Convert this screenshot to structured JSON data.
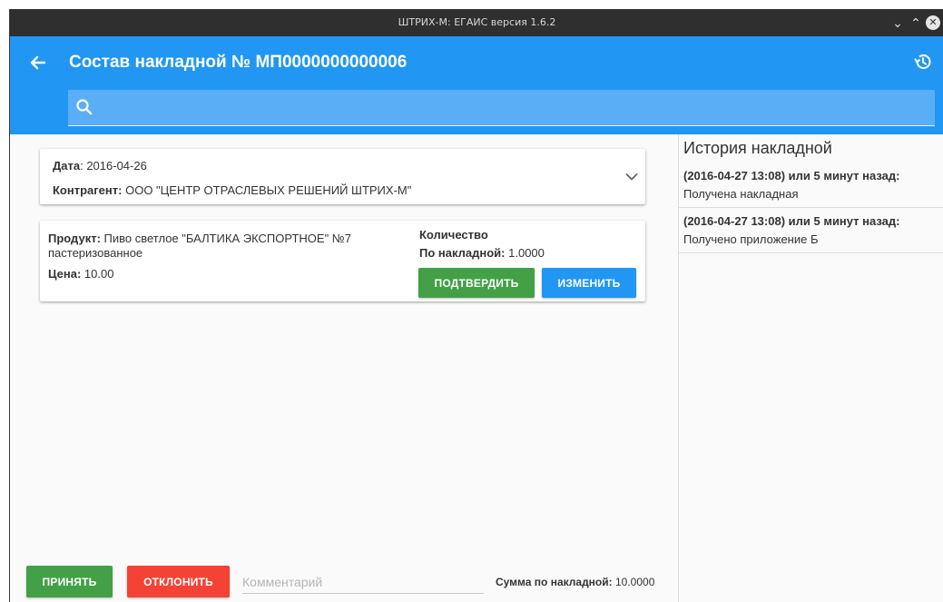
{
  "window": {
    "title": "ШТРИХ-М: ЕГАИС версия 1.6.2"
  },
  "appbar": {
    "title": "Состав накладной № МП0000000000006",
    "search_placeholder": ""
  },
  "invoice": {
    "date_label": "Дата",
    "date_value": "2016-04-26",
    "contractor_label": "Контрагент:",
    "contractor_value": "ООО \"ЦЕНТР ОТРАСЛЕВЫХ РЕШЕНИЙ ШТРИХ-М\""
  },
  "product": {
    "name_label": "Продукт:",
    "name_value": "Пиво светлое \"БАЛТИКА ЭКСПОРТНОЕ\" №7 пастеризованное",
    "price_label": "Цена:",
    "price_value": "10.00",
    "qty_title": "Количество",
    "qty_label": "По накладной:",
    "qty_value": "1.0000",
    "confirm_label": "ПОДТВЕРДИТЬ",
    "edit_label": "ИЗМЕНИТЬ"
  },
  "footer": {
    "accept_label": "ПРИНЯТЬ",
    "reject_label": "ОТКЛОНИТЬ",
    "comment_placeholder": "Комментарий",
    "total_label": "Сумма по накладной:",
    "total_value": "10.0000"
  },
  "history": {
    "title": "История накладной",
    "items": [
      {
        "time": "(2016-04-27 13:08) или 5 минут назад:",
        "event": "Получена накладная"
      },
      {
        "time": "(2016-04-27 13:08) или 5 минут назад:",
        "event": "Получено приложение Б"
      }
    ]
  },
  "colors": {
    "primary": "#2196f3",
    "success": "#43a047",
    "danger": "#f44336",
    "titlebar": "#2f2f2f"
  }
}
